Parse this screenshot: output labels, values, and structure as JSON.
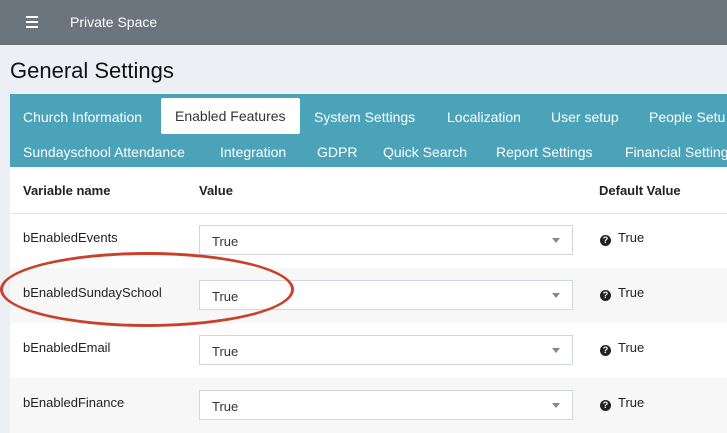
{
  "topbar": {
    "title": "Private Space",
    "menu_icon": "hamburger-menu-icon"
  },
  "page": {
    "title": "General Settings"
  },
  "tabs": {
    "row1": [
      {
        "label": "Church Information",
        "active": false
      },
      {
        "label": "Enabled Features",
        "active": true
      },
      {
        "label": "System Settings",
        "active": false
      },
      {
        "label": "Localization",
        "active": false
      },
      {
        "label": "User setup",
        "active": false
      },
      {
        "label": "People Setu",
        "active": false
      }
    ],
    "row2": [
      {
        "label": "Sundayschool Attendance",
        "active": false
      },
      {
        "label": "Integration",
        "active": false
      },
      {
        "label": "GDPR",
        "active": false
      },
      {
        "label": "Quick Search",
        "active": false
      },
      {
        "label": "Report Settings",
        "active": false
      },
      {
        "label": "Financial Setting",
        "active": false
      }
    ]
  },
  "table": {
    "headers": {
      "name": "Variable name",
      "value": "Value",
      "default": "Default Value"
    },
    "rows": [
      {
        "name": "bEnabledEvents",
        "value": "True",
        "default": "True"
      },
      {
        "name": "bEnabledSundaySchool",
        "value": "True",
        "default": "True"
      },
      {
        "name": "bEnabledEmail",
        "value": "True",
        "default": "True"
      },
      {
        "name": "bEnabledFinance",
        "value": "True",
        "default": "True"
      }
    ]
  },
  "colors": {
    "topbar": "#6c757d",
    "tabs_background": "#4aa3b9",
    "annotation_circle": "#c9412b"
  }
}
